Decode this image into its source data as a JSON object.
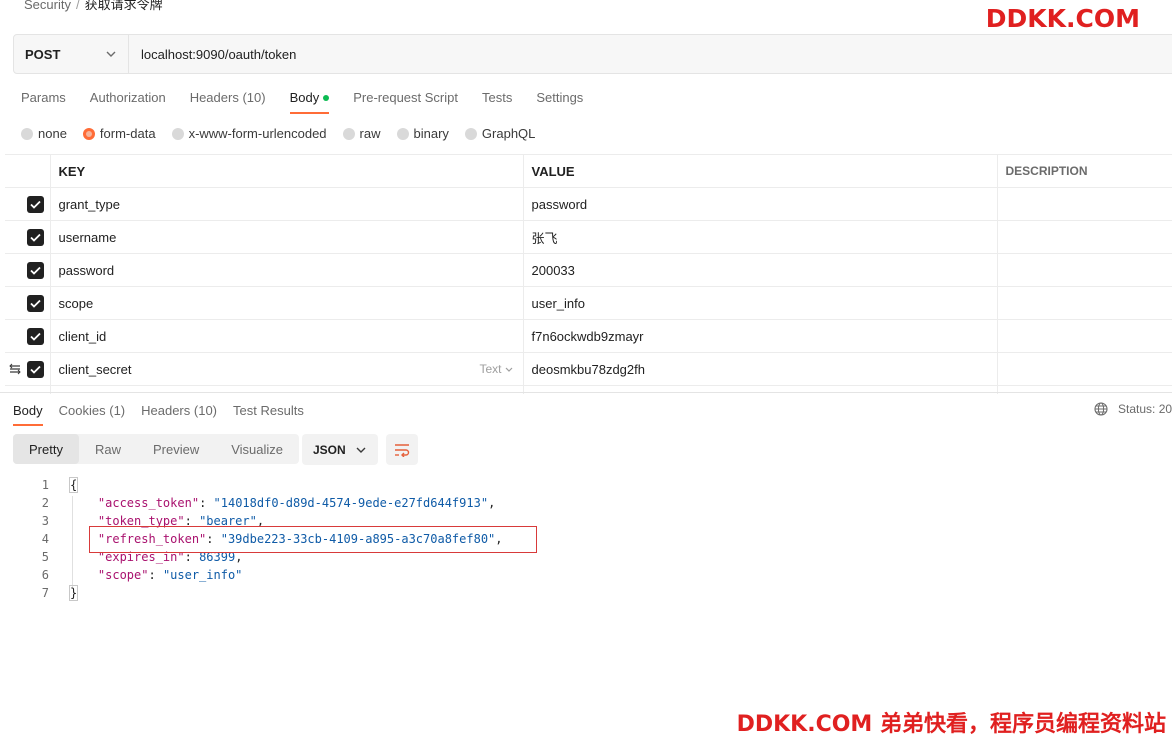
{
  "breadcrumb": {
    "parent": "Security",
    "separator": "/",
    "current": "获取请求令牌"
  },
  "watermark": {
    "top": "DDKK.COM",
    "bottom": "DDKK.COM 弟弟快看，程序员编程资料站"
  },
  "request": {
    "method": "POST",
    "url": "localhost:9090/oauth/token",
    "tabs": [
      {
        "label": "Params",
        "count": ""
      },
      {
        "label": "Authorization",
        "count": ""
      },
      {
        "label": "Headers",
        "count": "(10)"
      },
      {
        "label": "Body",
        "count": ""
      },
      {
        "label": "Pre-request Script",
        "count": ""
      },
      {
        "label": "Tests",
        "count": ""
      },
      {
        "label": "Settings",
        "count": ""
      }
    ],
    "body_types": [
      "none",
      "form-data",
      "x-www-form-urlencoded",
      "raw",
      "binary",
      "GraphQL"
    ],
    "selected_body_type": "form-data",
    "columns": {
      "key": "KEY",
      "value": "VALUE",
      "description": "DESCRIPTION"
    },
    "form_rows": [
      {
        "key": "grant_type",
        "value": "password"
      },
      {
        "key": "username",
        "value": "张飞"
      },
      {
        "key": "password",
        "value": "200033"
      },
      {
        "key": "scope",
        "value": "user_info"
      },
      {
        "key": "client_id",
        "value": "f7n6ockwdb9zmayr"
      },
      {
        "key": "client_secret",
        "value": "deosmkbu78zdg2fh",
        "type": "Text"
      }
    ]
  },
  "response": {
    "tabs": [
      {
        "label": "Body",
        "count": ""
      },
      {
        "label": "Cookies",
        "count": "(1)"
      },
      {
        "label": "Headers",
        "count": "(10)"
      },
      {
        "label": "Test Results",
        "count": ""
      }
    ],
    "status_label": "Status: 20",
    "view_tabs": [
      "Pretty",
      "Raw",
      "Preview",
      "Visualize"
    ],
    "format": "JSON",
    "lines": [
      {
        "n": "1"
      },
      {
        "n": "2",
        "key": "\"access_token\"",
        "val": "\"14018df0-d89d-4574-9ede-e27fd644f913\"",
        "end": ","
      },
      {
        "n": "3",
        "key": "\"token_type\"",
        "val": "\"bearer\"",
        "end": ","
      },
      {
        "n": "4",
        "key": "\"refresh_token\"",
        "val": "\"39dbe223-33cb-4109-a895-a3c70a8fef80\"",
        "end": ","
      },
      {
        "n": "5",
        "key": "\"expires_in\"",
        "val": "86399",
        "end": ","
      },
      {
        "n": "6",
        "key": "\"scope\"",
        "val": "\"user_info\"",
        "end": ""
      },
      {
        "n": "7"
      }
    ],
    "open_brace": "{",
    "close_brace": "}"
  }
}
